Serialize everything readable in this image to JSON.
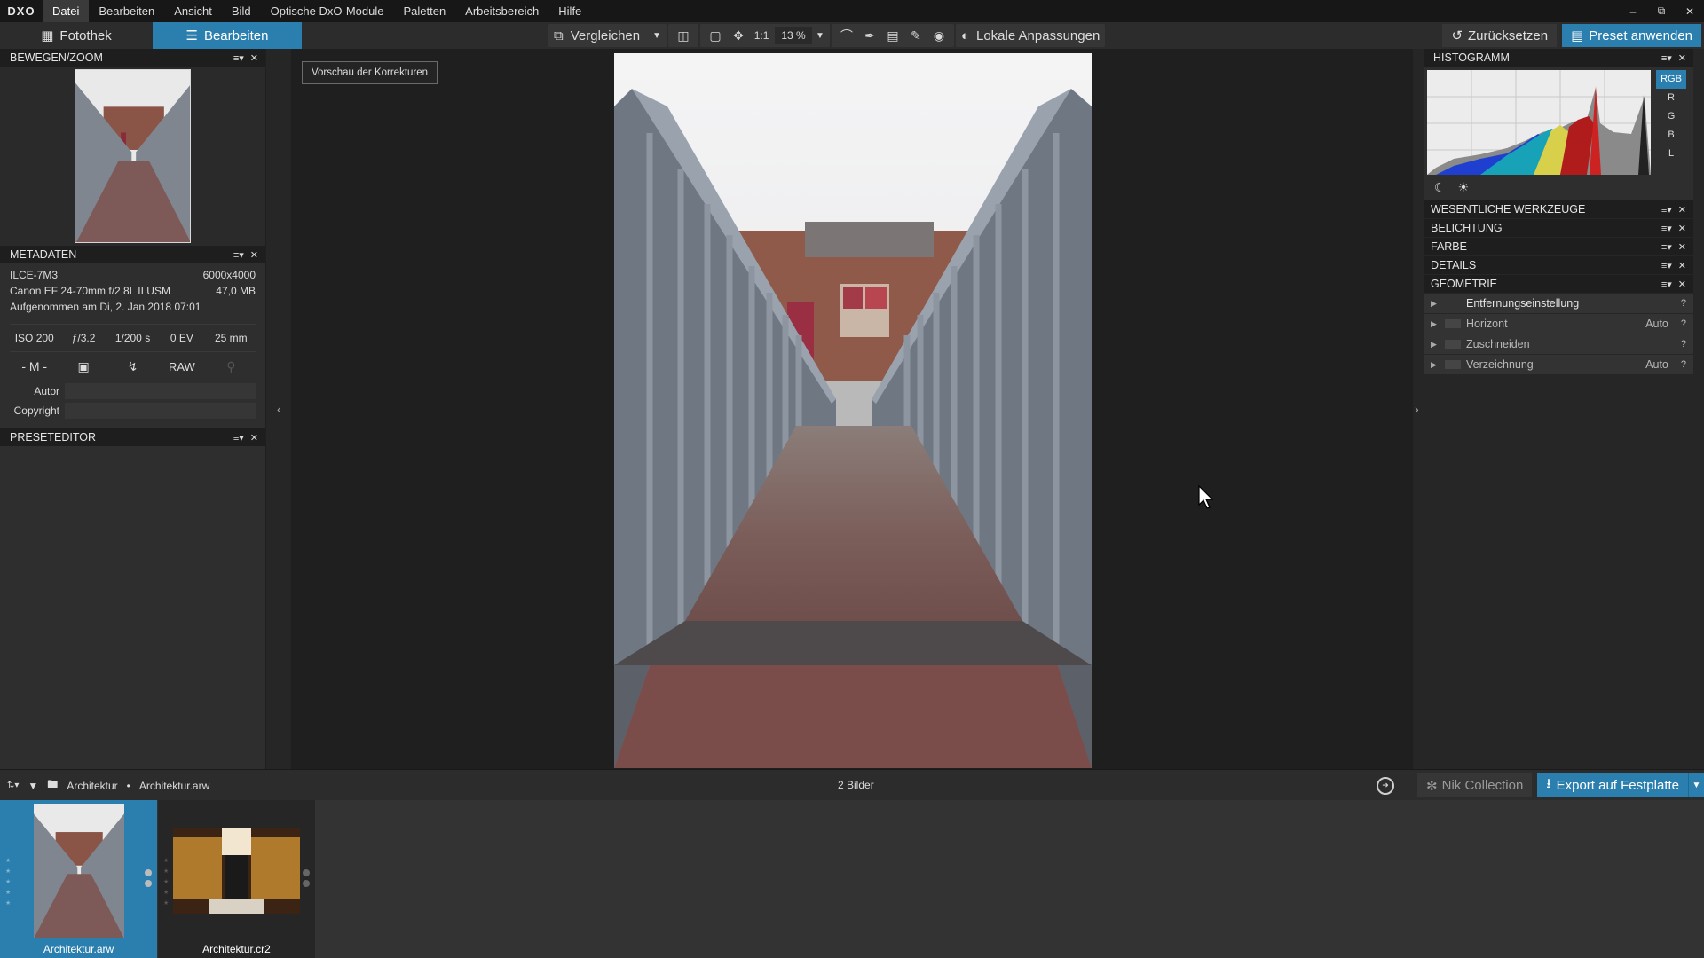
{
  "app": {
    "logo": "DXO"
  },
  "menu": [
    "Datei",
    "Bearbeiten",
    "Ansicht",
    "Bild",
    "Optische DxO-Module",
    "Paletten",
    "Arbeitsbereich",
    "Hilfe"
  ],
  "tabs": {
    "fotothek": "Fotothek",
    "bearbeiten": "Bearbeiten"
  },
  "toolbar": {
    "compare": "Vergleichen",
    "one_to_one": "1:1",
    "zoom": "13 %",
    "local_adjustments": "Lokale Anpassungen",
    "reset": "Zurücksetzen",
    "apply_preset": "Preset anwenden"
  },
  "left": {
    "navigator_title": "BEWEGEN/ZOOM",
    "metadata_title": "METADATEN",
    "camera": "ILCE-7M3",
    "dimensions": "6000x4000",
    "lens": "Canon EF 24-70mm f/2.8L II USM",
    "filesize": "47,0 MB",
    "captured": "Aufgenommen am Di, 2. Jan 2018 07:01",
    "exif": {
      "iso": "ISO 200",
      "aperture": "ƒ/3.2",
      "shutter": "1/200 s",
      "ev": "0 EV",
      "focal": "25 mm"
    },
    "mode": "- M -",
    "format": "RAW",
    "author_label": "Autor",
    "copyright_label": "Copyright",
    "preset_editor_title": "PRESETEDITOR"
  },
  "center": {
    "preview_badge": "Vorschau der Korrekturen"
  },
  "right": {
    "histogram_title": "HISTOGRAMM",
    "channels": [
      "RGB",
      "R",
      "G",
      "B",
      "L"
    ],
    "sections": [
      "WESENTLICHE WERKZEUGE",
      "BELICHTUNG",
      "FARBE",
      "DETAILS",
      "GEOMETRIE"
    ],
    "geometry_items": [
      {
        "label": "Entfernungseinstellung",
        "value": ""
      },
      {
        "label": "Horizont",
        "value": "Auto"
      },
      {
        "label": "Zuschneiden",
        "value": ""
      },
      {
        "label": "Verzeichnung",
        "value": "Auto"
      }
    ]
  },
  "filmstrip": {
    "folder": "Architektur",
    "file": "Architektur.arw",
    "count": "2 Bilder",
    "nik": "Nik Collection",
    "export": "Export auf Festplatte",
    "images": [
      "Architektur.arw",
      "Architektur.cr2"
    ]
  },
  "colors": {
    "accent": "#2b7fae",
    "background": "#262626"
  }
}
